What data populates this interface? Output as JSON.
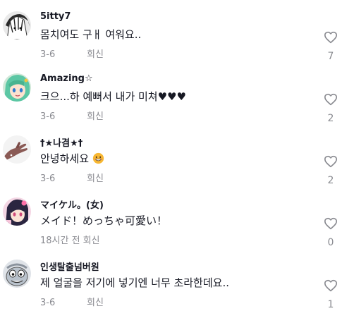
{
  "comments": [
    {
      "username": "5itty7",
      "text": "몸치여도 구ㅐ 여워요..",
      "date": "3-6",
      "reply_label": "회신",
      "likes": "7",
      "avatar_icon": "manga-avatar-icon"
    },
    {
      "username": "Amazing☆",
      "text": "크으...하 예뻐서 내가 미쳐♥♥♥",
      "date": "3-6",
      "reply_label": "회신",
      "likes": "2",
      "avatar_icon": "anime-green-hair-avatar-icon"
    },
    {
      "username": "†★나겸★†",
      "text": "안녕하세요",
      "emoji": "grinning-face-icon",
      "date": "3-6",
      "reply_label": "회신",
      "likes": "2",
      "avatar_icon": "hand-avatar-icon"
    },
    {
      "username": "マイケル。(女)",
      "text": "メイド！めっちゃ可愛い！",
      "date": "18시간 전",
      "reply_label": "회신",
      "likes": "0",
      "avatar_icon": "anime-pink-avatar-icon"
    },
    {
      "username": "인생탈출넘버원",
      "text": "제 얼굴을 저기에 넣기엔 너무 초라한데요..",
      "date": "3-6",
      "reply_label": "회신",
      "likes": "1",
      "avatar_icon": "cartoon-character-avatar-icon"
    }
  ],
  "colors": {
    "text": "#161823",
    "muted": "#8a8b91",
    "heart_stroke": "#8a8b91"
  }
}
